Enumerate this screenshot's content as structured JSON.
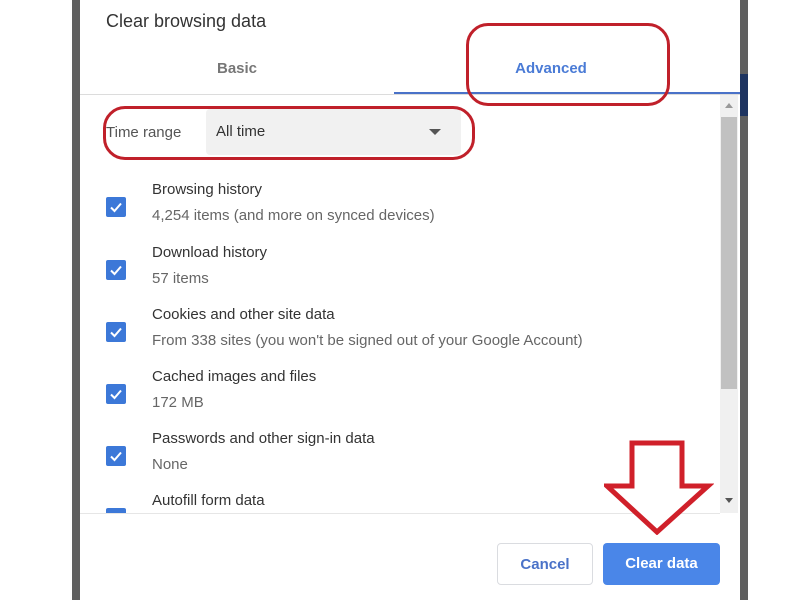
{
  "dialog": {
    "title": "Clear browsing data",
    "tabs": [
      {
        "label": "Basic",
        "active": false
      },
      {
        "label": "Advanced",
        "active": true
      }
    ],
    "time_range": {
      "label": "Time range",
      "selected": "All time"
    },
    "items": [
      {
        "title": "Browsing history",
        "subtitle": "4,254 items (and more on synced devices)",
        "checked": true
      },
      {
        "title": "Download history",
        "subtitle": "57 items",
        "checked": true
      },
      {
        "title": "Cookies and other site data",
        "subtitle": "From 338 sites (you won't be signed out of your Google Account)",
        "checked": true
      },
      {
        "title": "Cached images and files",
        "subtitle": "172 MB",
        "checked": true
      },
      {
        "title": "Passwords and other sign-in data",
        "subtitle": "None",
        "checked": true
      },
      {
        "title": "Autofill form data",
        "subtitle": "",
        "checked": true
      }
    ],
    "buttons": {
      "cancel": "Cancel",
      "clear": "Clear data"
    }
  },
  "colors": {
    "accent": "#4a86e8",
    "checkbox": "#3c78d8",
    "annotation": "#c0202a"
  }
}
